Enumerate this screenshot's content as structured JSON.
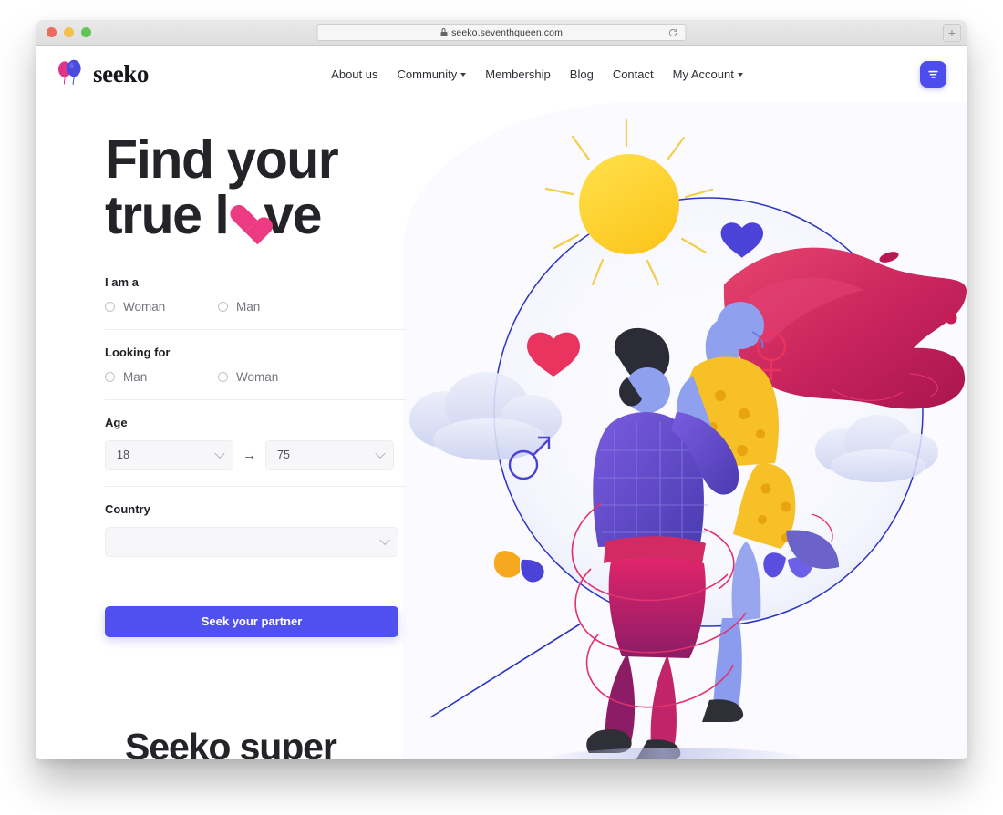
{
  "browser": {
    "url": "seeko.seventhqueen.com",
    "lock_icon": "lock-icon",
    "reload_icon": "reload-icon",
    "new_tab_label": "+",
    "traffic_lights": [
      "close",
      "minimize",
      "maximize"
    ]
  },
  "header": {
    "logo_text": "seeko",
    "logo_icon": "balloons-icon",
    "nav": [
      {
        "label": "About us",
        "has_dropdown": false
      },
      {
        "label": "Community",
        "has_dropdown": true
      },
      {
        "label": "Membership",
        "has_dropdown": false
      },
      {
        "label": "Blog",
        "has_dropdown": false
      },
      {
        "label": "Contact",
        "has_dropdown": false
      },
      {
        "label": "My Account",
        "has_dropdown": true
      }
    ],
    "action_icon": "filter-icon",
    "action_color": "#4d4ded"
  },
  "hero": {
    "headline_line1": "Find your",
    "headline_line2_a": "true l",
    "headline_line2_b": "ve",
    "heart_color": "#ec3b82",
    "form": {
      "i_am_a": {
        "label": "I am a",
        "options": [
          {
            "label": "Woman",
            "selected": false
          },
          {
            "label": "Man",
            "selected": false
          }
        ]
      },
      "looking_for": {
        "label": "Looking for",
        "options": [
          {
            "label": "Man",
            "selected": false
          },
          {
            "label": "Woman",
            "selected": false
          }
        ]
      },
      "age": {
        "label": "Age",
        "min_value": "18",
        "max_value": "75",
        "separator": "→"
      },
      "country": {
        "label": "Country",
        "value": "",
        "placeholder": ""
      },
      "submit_label": "Seek your partner",
      "submit_color": "#5050ee"
    },
    "illustration_name": "couple-in-magnifying-glass-illustration"
  },
  "next_section": {
    "title": "Seeko super"
  }
}
